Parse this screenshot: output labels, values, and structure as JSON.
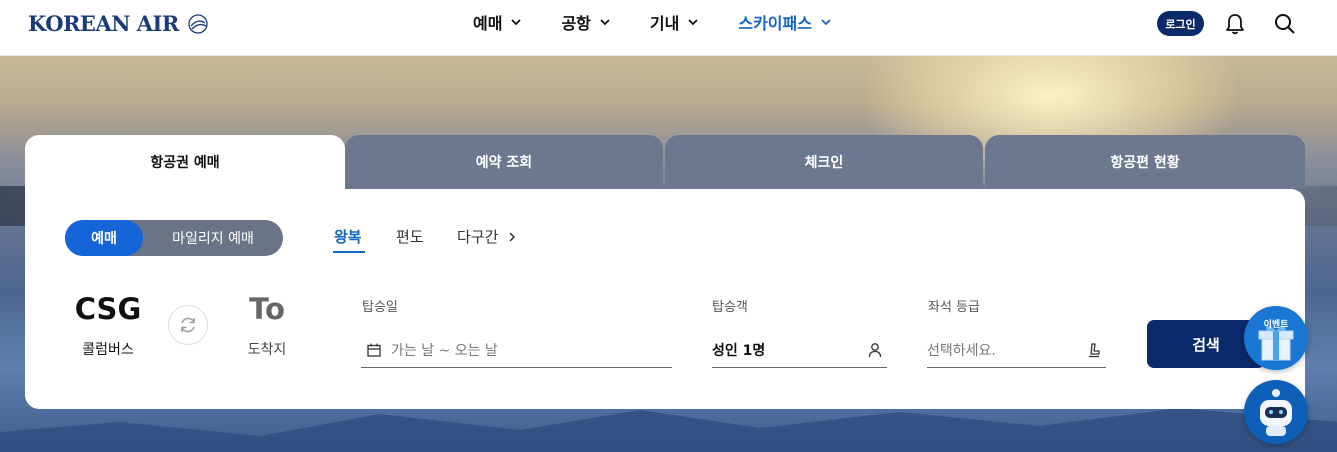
{
  "brand": {
    "name": "KOREAN AIR"
  },
  "nav": [
    {
      "label": "예매",
      "active": false
    },
    {
      "label": "공항",
      "active": false
    },
    {
      "label": "기내",
      "active": false
    },
    {
      "label": "스카이패스",
      "active": true
    }
  ],
  "header": {
    "login_label": "로그인"
  },
  "tabs": [
    {
      "label": "항공권 예매",
      "active": true
    },
    {
      "label": "예약 조회",
      "active": false
    },
    {
      "label": "체크인",
      "active": false
    },
    {
      "label": "항공편 현황",
      "active": false
    }
  ],
  "booking_type": {
    "selected": "예매",
    "other": "마일리지 예매"
  },
  "trip_types": [
    {
      "label": "왕복",
      "active": true
    },
    {
      "label": "편도",
      "active": false
    },
    {
      "label": "다구간",
      "active": false
    }
  ],
  "origin": {
    "code": "CSG",
    "name": "콜럼버스"
  },
  "destination": {
    "code": "To",
    "name": "도착지"
  },
  "fields": {
    "date_label": "탑승일",
    "date_placeholder": "가는 날 ~ 오는 날",
    "passenger_label": "탑승객",
    "passenger_value": "성인 1명",
    "class_label": "좌석 등급",
    "class_placeholder": "선택하세요."
  },
  "search_label": "검색",
  "event_label": "이벤트",
  "colors": {
    "primary": "#0b2a6b",
    "accent": "#1565d8",
    "tab_inactive": "#6b7890"
  }
}
